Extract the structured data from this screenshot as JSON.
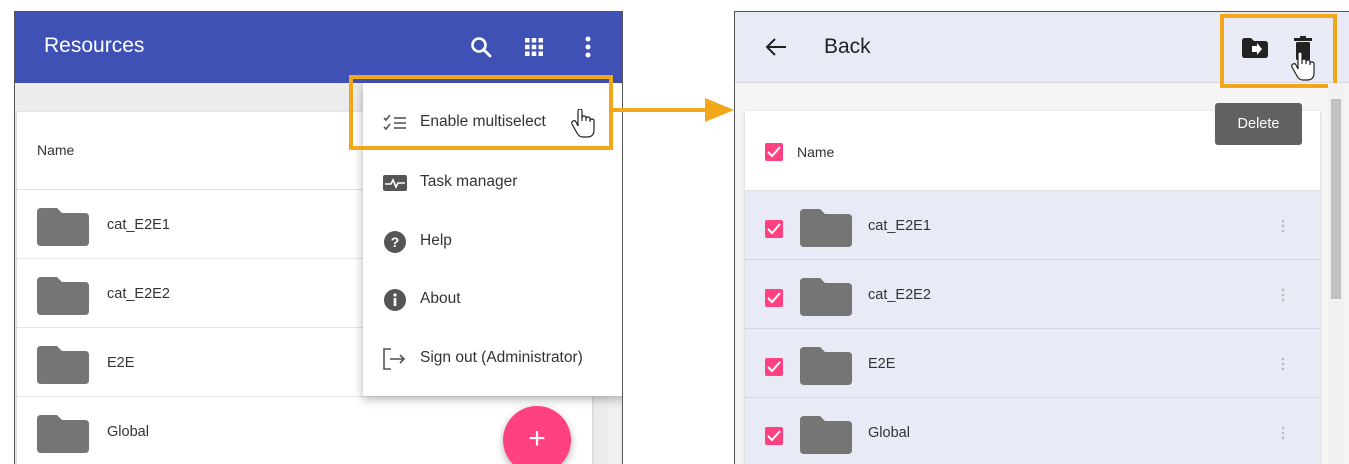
{
  "left": {
    "app_title": "Resources",
    "icons": [
      "search-icon",
      "grid-icon",
      "more-vert-icon"
    ],
    "list": {
      "header": "Name",
      "rows": [
        "cat_E2E1",
        "cat_E2E2",
        "E2E",
        "Global"
      ]
    },
    "menu": {
      "items": [
        {
          "label": "Enable multiselect",
          "icon": "multiselect-icon"
        },
        {
          "label": "Task manager",
          "icon": "task-manager-icon"
        },
        {
          "label": "Help",
          "icon": "help-icon"
        },
        {
          "label": "About",
          "icon": "info-icon"
        },
        {
          "label": "Sign out (Administrator)",
          "icon": "sign-out-icon"
        }
      ]
    },
    "fab_icon": "+"
  },
  "right": {
    "back_label": "Back",
    "icons": [
      "back-arrow-icon",
      "move-to-folder-icon",
      "delete-icon"
    ],
    "tooltip": "Delete",
    "list": {
      "header": "Name",
      "rows": [
        "cat_E2E1",
        "cat_E2E2",
        "E2E",
        "Global"
      ]
    }
  },
  "colors": {
    "primary": "#3f51b5",
    "accent": "#ff4081",
    "highlight": "#f2a71b",
    "selected_row": "#e8eaf6"
  }
}
